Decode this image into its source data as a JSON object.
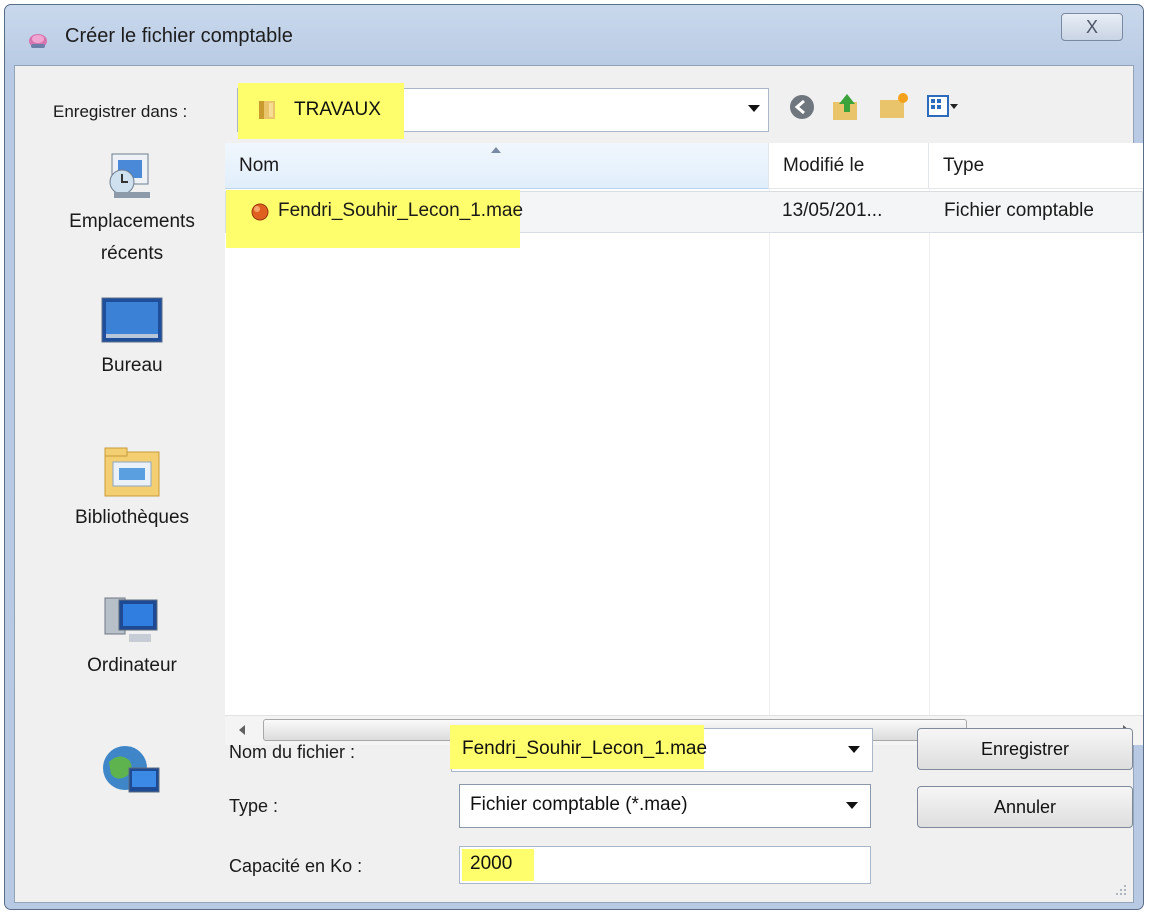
{
  "window": {
    "title": "Créer le fichier comptable",
    "close_label": "X"
  },
  "header": {
    "save_in_label": "Enregistrer dans :",
    "folder": "TRAVAUX"
  },
  "places": [
    {
      "label": "Emplacements récents",
      "icon": "recent-places-icon"
    },
    {
      "label": "Bureau",
      "icon": "desktop-icon"
    },
    {
      "label": "Bibliothèques",
      "icon": "libraries-icon"
    },
    {
      "label": "Ordinateur",
      "icon": "computer-icon"
    },
    {
      "label": "",
      "icon": "network-icon"
    }
  ],
  "filelist": {
    "columns": [
      "Nom",
      "Modifié le",
      "Type"
    ],
    "rows": [
      {
        "name": "Fendri_Souhir_Lecon_1.mae",
        "modified": "13/05/201...",
        "type": "Fichier comptable"
      }
    ],
    "scroll_thumb": "III"
  },
  "form": {
    "filename_label": "Nom du fichier :",
    "filename_value": "Fendri_Souhir_Lecon_1.mae",
    "type_label": "Type :",
    "type_value": "Fichier comptable (*.mae)",
    "capacity_label": "Capacité en Ko :",
    "capacity_value": "2000"
  },
  "buttons": {
    "save": "Enregistrer",
    "cancel": "Annuler"
  },
  "colors": {
    "highlight": "#fefd6b",
    "title_bar": "#c9d8ec",
    "dialog_bg": "#f0f0f0"
  }
}
